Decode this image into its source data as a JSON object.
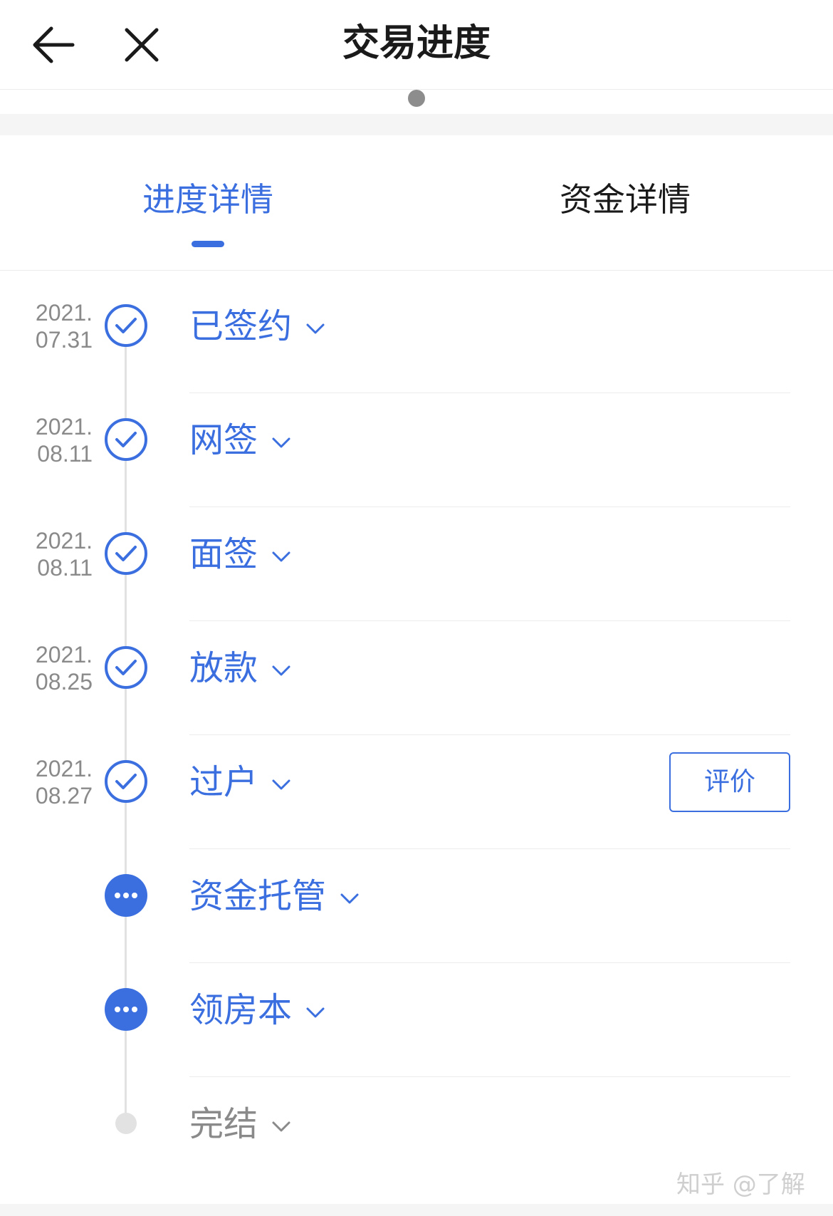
{
  "header": {
    "title": "交易进度",
    "back_icon": "arrow-left-icon",
    "close_icon": "close-icon"
  },
  "tabs": [
    {
      "label": "进度详情",
      "active": true
    },
    {
      "label": "资金详情",
      "active": false
    }
  ],
  "colors": {
    "accent": "#3b6fe0",
    "text": "#1a1a1a",
    "muted": "#8a8a8a",
    "line": "#e2e2e2"
  },
  "steps": [
    {
      "date_year": "2021.",
      "date_md": "07.31",
      "label": "已签约",
      "status": "done"
    },
    {
      "date_year": "2021.",
      "date_md": "08.11",
      "label": "网签",
      "status": "done"
    },
    {
      "date_year": "2021.",
      "date_md": "08.11",
      "label": "面签",
      "status": "done"
    },
    {
      "date_year": "2021.",
      "date_md": "08.25",
      "label": "放款",
      "status": "done"
    },
    {
      "date_year": "2021.",
      "date_md": "08.27",
      "label": "过户",
      "status": "done",
      "action": "评价"
    },
    {
      "label": "资金托管",
      "status": "in-progress"
    },
    {
      "label": "领房本",
      "status": "in-progress"
    },
    {
      "label": "完结",
      "status": "pending"
    }
  ],
  "watermark": "知乎 @了解"
}
